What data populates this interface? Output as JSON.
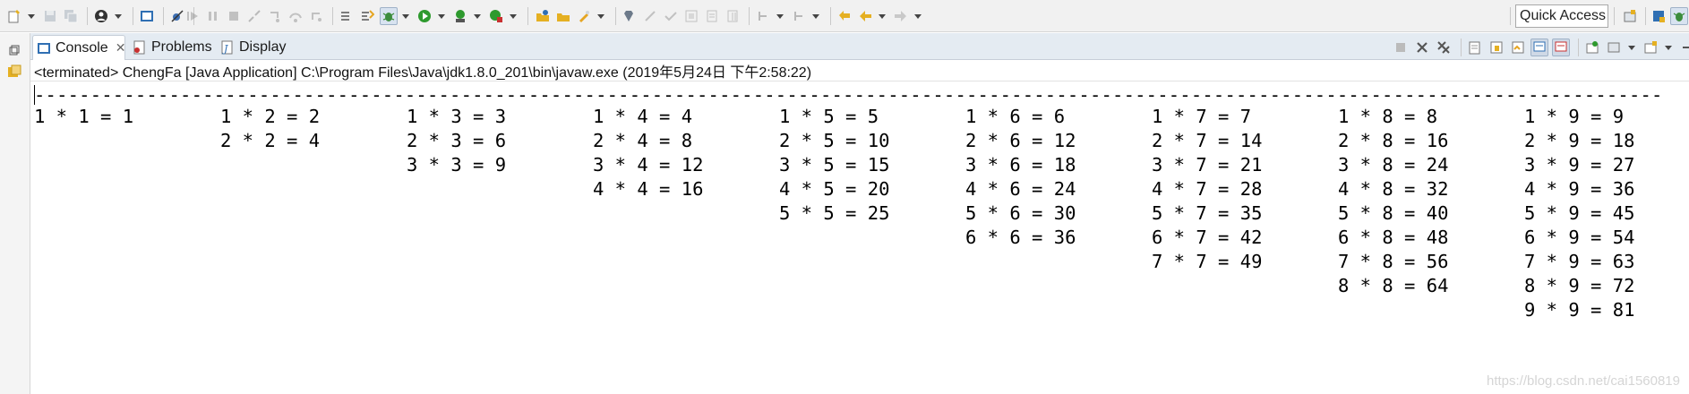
{
  "toolbar": {
    "quick_access_label": "Quick Access",
    "icons": [
      "new-icon",
      "save-icon",
      "save-all-icon",
      "profile-icon",
      "terminal-icon",
      "skip-breakpoints-icon",
      "resume-icon",
      "suspend-icon",
      "terminate-icon",
      "disconnect-icon",
      "step-into-icon",
      "step-over-icon",
      "step-return-icon",
      "drop-frame-icon",
      "use-step-filters-icon",
      "debug-icon",
      "run-icon",
      "coverage-icon",
      "external-tools-icon",
      "new-java-project-icon",
      "open-type-icon",
      "open-task-icon",
      "search-icon",
      "toggle-annotation-icon",
      "next-annotation-icon",
      "prev-annotation-icon",
      "back-icon",
      "forward-icon"
    ]
  },
  "tabs": [
    {
      "label": "Console",
      "active": true
    },
    {
      "label": "Problems",
      "active": false
    },
    {
      "label": "Display",
      "active": false
    }
  ],
  "console": {
    "header": "<terminated> ChengFa [Java Application] C:\\Program Files\\Java\\jdk1.8.0_201\\bin\\javaw.exe (2019年5月24日 下午2:58:22)",
    "dash_line": "---------------------------------------------------------------------------------------------------------------------------------------------------------------------------",
    "columns": [
      [
        "1 * 1 = 1"
      ],
      [
        "1 * 2 = 2",
        "2 * 2 = 4"
      ],
      [
        "1 * 3 = 3",
        "2 * 3 = 6",
        "3 * 3 = 9"
      ],
      [
        "1 * 4 = 4",
        "2 * 4 = 8",
        "3 * 4 = 12",
        "4 * 4 = 16"
      ],
      [
        "1 * 5 = 5",
        "2 * 5 = 10",
        "3 * 5 = 15",
        "4 * 5 = 20",
        "5 * 5 = 25"
      ],
      [
        "1 * 6 = 6",
        "2 * 6 = 12",
        "3 * 6 = 18",
        "4 * 6 = 24",
        "5 * 6 = 30",
        "6 * 6 = 36"
      ],
      [
        "1 * 7 = 7",
        "2 * 7 = 14",
        "3 * 7 = 21",
        "4 * 7 = 28",
        "5 * 7 = 35",
        "6 * 7 = 42",
        "7 * 7 = 49"
      ],
      [
        "1 * 8 = 8",
        "2 * 8 = 16",
        "3 * 8 = 24",
        "4 * 8 = 32",
        "5 * 8 = 40",
        "6 * 8 = 48",
        "7 * 8 = 56",
        "8 * 8 = 64"
      ],
      [
        "1 * 9 = 9",
        "2 * 9 = 18",
        "3 * 9 = 27",
        "4 * 9 = 36",
        "5 * 9 = 45",
        "6 * 9 = 54",
        "7 * 9 = 63",
        "8 * 9 = 72",
        "9 * 9 = 81"
      ]
    ]
  },
  "watermark": "https://blog.csdn.net/cai1560819",
  "colors": {
    "accent": "#2f6fb3",
    "run_green": "#2e9a2e",
    "debug_green": "#3c8d3c",
    "error_red": "#c93030"
  }
}
